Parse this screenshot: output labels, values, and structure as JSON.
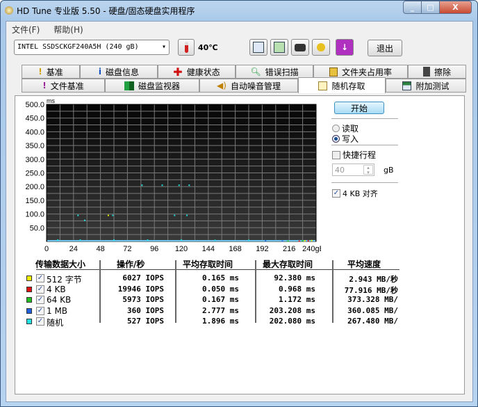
{
  "window": {
    "title": "HD Tune 专业版 5.50 - 硬盘/固态硬盘实用程序",
    "minimize": "_",
    "maximize": "□",
    "close": "X"
  },
  "menu": [
    "文件(F)",
    "帮助(H)"
  ],
  "toolbar": {
    "drive": "INTEL SSDSCKGF240A5H (240 gB)",
    "temperature": "40℃",
    "exit": "退出"
  },
  "tabs_row1": [
    "基准",
    "磁盘信息",
    "健康状态",
    "错误扫描",
    "文件夹占用率",
    "擦除"
  ],
  "tabs_row2": [
    "文件基准",
    "磁盘监视器",
    "自动噪音管理",
    "随机存取",
    "附加测试"
  ],
  "active_tab": "随机存取",
  "controls": {
    "start": "开始",
    "read": "读取",
    "write": "写入",
    "selected_mode": "写入",
    "quick_stroke": "快捷行程",
    "quick_checked": false,
    "stroke_value": "40",
    "stroke_unit": "gB",
    "align": "4 KB 对齐",
    "align_checked": true
  },
  "colors": {
    "plot_bg_top": "#050505",
    "plot_bg_bottom": "#3a3a3a",
    "grid": "#7a7a7a",
    "accent": "#6cc6ee"
  },
  "chart_data": {
    "type": "scatter",
    "ylabel": "ms",
    "xlabel": "gB",
    "ylim": [
      0,
      500
    ],
    "xlim": [
      0,
      240
    ],
    "yticks": [
      "500.0",
      "450.0",
      "400.0",
      "350.0",
      "300.0",
      "250.0",
      "200.0",
      "150.0",
      "100.0",
      "50.0"
    ],
    "xticks": [
      "0",
      "24",
      "48",
      "72",
      "96",
      "120",
      "144",
      "168",
      "192",
      "216",
      "240gB"
    ],
    "grid": true,
    "series": [
      {
        "name": "512 字节",
        "color": "#f0f000",
        "points": [
          [
            55,
            95
          ],
          [
            230,
            2
          ],
          [
            236,
            3
          ]
        ]
      },
      {
        "name": "4 KB",
        "color": "#e01010",
        "points": [
          [
            225,
            1
          ],
          [
            233,
            2
          ]
        ]
      },
      {
        "name": "64 KB",
        "color": "#20c020",
        "points": [
          [
            215,
            1
          ],
          [
            228,
            2
          ]
        ]
      },
      {
        "name": "1 MB",
        "color": "#2060e0",
        "points": [
          [
            195,
            2
          ],
          [
            210,
            1
          ]
        ]
      },
      {
        "name": "随机",
        "color": "#20e0e0",
        "points": [
          [
            28,
            95
          ],
          [
            34,
            77
          ],
          [
            59,
            95
          ],
          [
            85,
            205
          ],
          [
            103,
            205
          ],
          [
            118,
            205
          ],
          [
            127,
            205
          ],
          [
            114,
            95
          ],
          [
            125,
            95
          ],
          [
            10,
            5
          ],
          [
            30,
            5
          ],
          [
            60,
            5
          ],
          [
            90,
            5
          ],
          [
            120,
            5
          ],
          [
            150,
            4
          ],
          [
            180,
            4
          ]
        ]
      }
    ]
  },
  "table": {
    "headers": [
      "传输数据大小",
      "操作/秒",
      "平均存取时间",
      "最大存取时间",
      "平均速度"
    ],
    "rows": [
      {
        "color": "#f0f000",
        "label": "512 字节",
        "iops": "6027 IOPS",
        "avg": "0.165 ms",
        "max": "92.380 ms",
        "speed": "2.943 MB/秒"
      },
      {
        "color": "#e01010",
        "label": "4 KB",
        "iops": "19946 IOPS",
        "avg": "0.050 ms",
        "max": "0.968 ms",
        "speed": "77.916 MB/秒"
      },
      {
        "color": "#20c020",
        "label": "64 KB",
        "iops": "5973 IOPS",
        "avg": "0.167 ms",
        "max": "1.172 ms",
        "speed": "373.328 MB/"
      },
      {
        "color": "#2060e0",
        "label": "1 MB",
        "iops": "360 IOPS",
        "avg": "2.777 ms",
        "max": "203.208 ms",
        "speed": "360.085 MB/"
      },
      {
        "color": "#20e0e0",
        "label": "随机",
        "iops": "527 IOPS",
        "avg": "1.896 ms",
        "max": "202.080 ms",
        "speed": "267.480 MB/"
      }
    ]
  }
}
